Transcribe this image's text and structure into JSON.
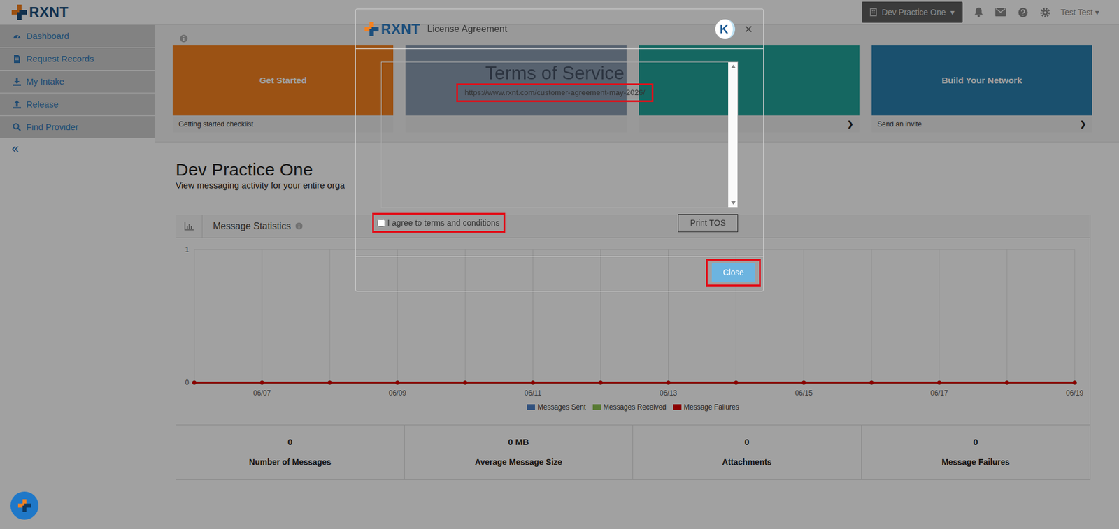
{
  "header": {
    "logo": "RXNT",
    "practice": "Dev Practice One",
    "practice_caret": "▾",
    "user": "Test Test",
    "user_caret": "▾"
  },
  "sidebar": {
    "items": [
      {
        "label": "Dashboard"
      },
      {
        "label": "Request Records"
      },
      {
        "label": "My Intake"
      },
      {
        "label": "Release"
      },
      {
        "label": "Find Provider"
      }
    ],
    "collapse": "«"
  },
  "tiles": [
    {
      "title": "Get Started",
      "caption": "Getting started checklist",
      "arrow": "",
      "color": "#f58220"
    },
    {
      "title": "",
      "caption": "",
      "arrow": "",
      "color": "#8a9bb0"
    },
    {
      "title": "",
      "caption": "",
      "arrow": "❯",
      "color": "#22a39a"
    },
    {
      "title": "Build Your Network",
      "caption": "Send an invite",
      "arrow": "❯",
      "color": "#2a7fae"
    }
  ],
  "dashboard": {
    "title": "Dev Practice One",
    "subtitle": "View messaging activity for your entire orga"
  },
  "stats_panel": {
    "title": "Message Statistics",
    "chart": {
      "y_ticks": [
        "1",
        "0"
      ],
      "y_max": 1,
      "x_labels": [
        "",
        "06/07",
        "",
        "06/09",
        "",
        "06/11",
        "",
        "06/13",
        "",
        "06/15",
        "",
        "06/17",
        "",
        "06/19"
      ],
      "series": [
        {
          "name": "Messages Sent",
          "color": "#4f81c8",
          "values": [
            0,
            0,
            0,
            0,
            0,
            0,
            0,
            0,
            0,
            0,
            0,
            0,
            0,
            0
          ]
        },
        {
          "name": "Messages Received",
          "color": "#8cc152",
          "values": [
            0,
            0,
            0,
            0,
            0,
            0,
            0,
            0,
            0,
            0,
            0,
            0,
            0,
            0
          ]
        },
        {
          "name": "Message Failures",
          "color": "#dd0000",
          "values": [
            0,
            0,
            0,
            0,
            0,
            0,
            0,
            0,
            0,
            0,
            0,
            0,
            0,
            0
          ]
        }
      ]
    },
    "stats": [
      {
        "value": "0",
        "label": "Number of Messages"
      },
      {
        "value": "0 MB",
        "label": "Average Message Size"
      },
      {
        "value": "0",
        "label": "Attachments"
      },
      {
        "value": "0",
        "label": "Message Failures"
      }
    ]
  },
  "modal": {
    "logo": "RXNT",
    "title": "License Agreement",
    "badge": "K",
    "close_icon": "×",
    "tos_heading": "Terms of Service",
    "tos_link": {
      "text": "https://www.rxnt.com/customer-agreement-may-2026/",
      "highlighted": true
    },
    "agree": {
      "label": "I agree to terms and conditions",
      "checked": false,
      "highlighted": true
    },
    "print": {
      "label": "Print TOS",
      "disabled": true
    },
    "close_button": {
      "label": "Close",
      "highlighted": true
    }
  }
}
